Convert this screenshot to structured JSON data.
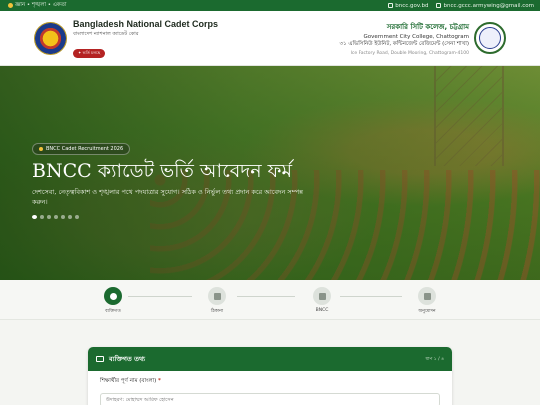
{
  "topbar": {
    "left_text": "জ্ঞান • শৃঙ্খলা • একতা",
    "website": "bncc.gov.bd",
    "email": "bncc.gccc.armywing@gmail.com"
  },
  "header": {
    "org_name": "Bangladesh National Cadet Corps",
    "org_name_bn": "বাংলাদেশ ন্যাশনাল ক্যাডেট কোর",
    "badge": "✦ ভর্তি চলছে",
    "college_name_bn": "সরকারি সিটি কলেজ, চট্টগ্রাম",
    "college_name_en": "Government City College, Chattogram",
    "unit": "৩১ এভিসিনিউ ইউনিট, কন্টিনজেন্ট রেজিমেন্ট (সেনা শাখা)",
    "address": "Ice Factory Road, Double Mooring, Chattogram-4100"
  },
  "hero": {
    "pill": "BNCC Cadet Recruitment 2026",
    "title": "BNCC ক্যাডেট ভর্তি আবেদন ফর্ম",
    "subtitle": "দেশসেবা, নেতৃত্ববিকাশ ও শৃঙ্খলার পথে পদযাত্রার সুযোগ। সঠিক ও নির্ভুল তথ্য প্রদান করে আবেদন সম্পন্ন করুন।",
    "slide_count": 7,
    "active_slide": 1
  },
  "steps": [
    {
      "label": "ব্যক্তিগত",
      "icon": "person-icon",
      "active": true
    },
    {
      "label": "ঠিকানা",
      "icon": "map-icon",
      "active": false
    },
    {
      "label": "BNCC",
      "icon": "star-icon",
      "active": false
    },
    {
      "label": "অনুমোদন",
      "icon": "upload-icon",
      "active": false
    }
  ],
  "form": {
    "section_title": "ব্যক্তিগত তথ্য",
    "step_indicator": "ধাপ ১ / ৪",
    "field_label": "শিক্ষার্থীর পূর্ণ নাম (বাংলা)",
    "required_mark": "*",
    "field_placeholder": "উদাহরণ: মোহাম্মদ আরিফ হোসেন"
  },
  "colors": {
    "brand_green": "#1b6a2f",
    "accent_gold": "#f2c23b",
    "badge_red": "#b42323"
  }
}
